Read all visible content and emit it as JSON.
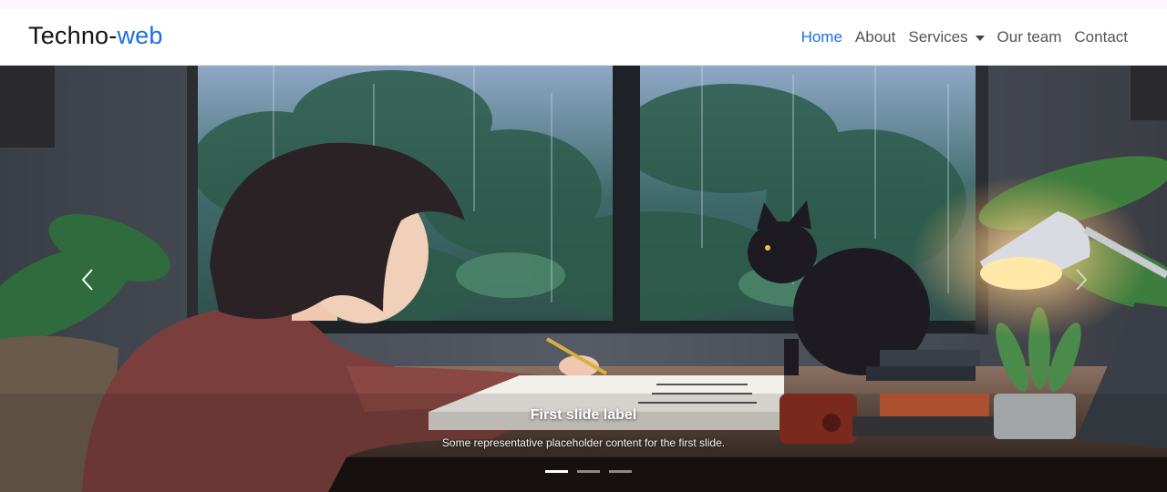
{
  "brand": {
    "part1": "Techno-",
    "part2": "web"
  },
  "nav": {
    "home": "Home",
    "about": "About",
    "services": "Services",
    "team": "Our team",
    "contact": "Contact"
  },
  "carousel": {
    "active_index": 0,
    "slide_count": 3,
    "caption_title": "First slide label",
    "caption_text": "Some representative placeholder content for the first slide."
  },
  "colors": {
    "accent": "#1a6ee3",
    "nav_text": "#555555"
  }
}
